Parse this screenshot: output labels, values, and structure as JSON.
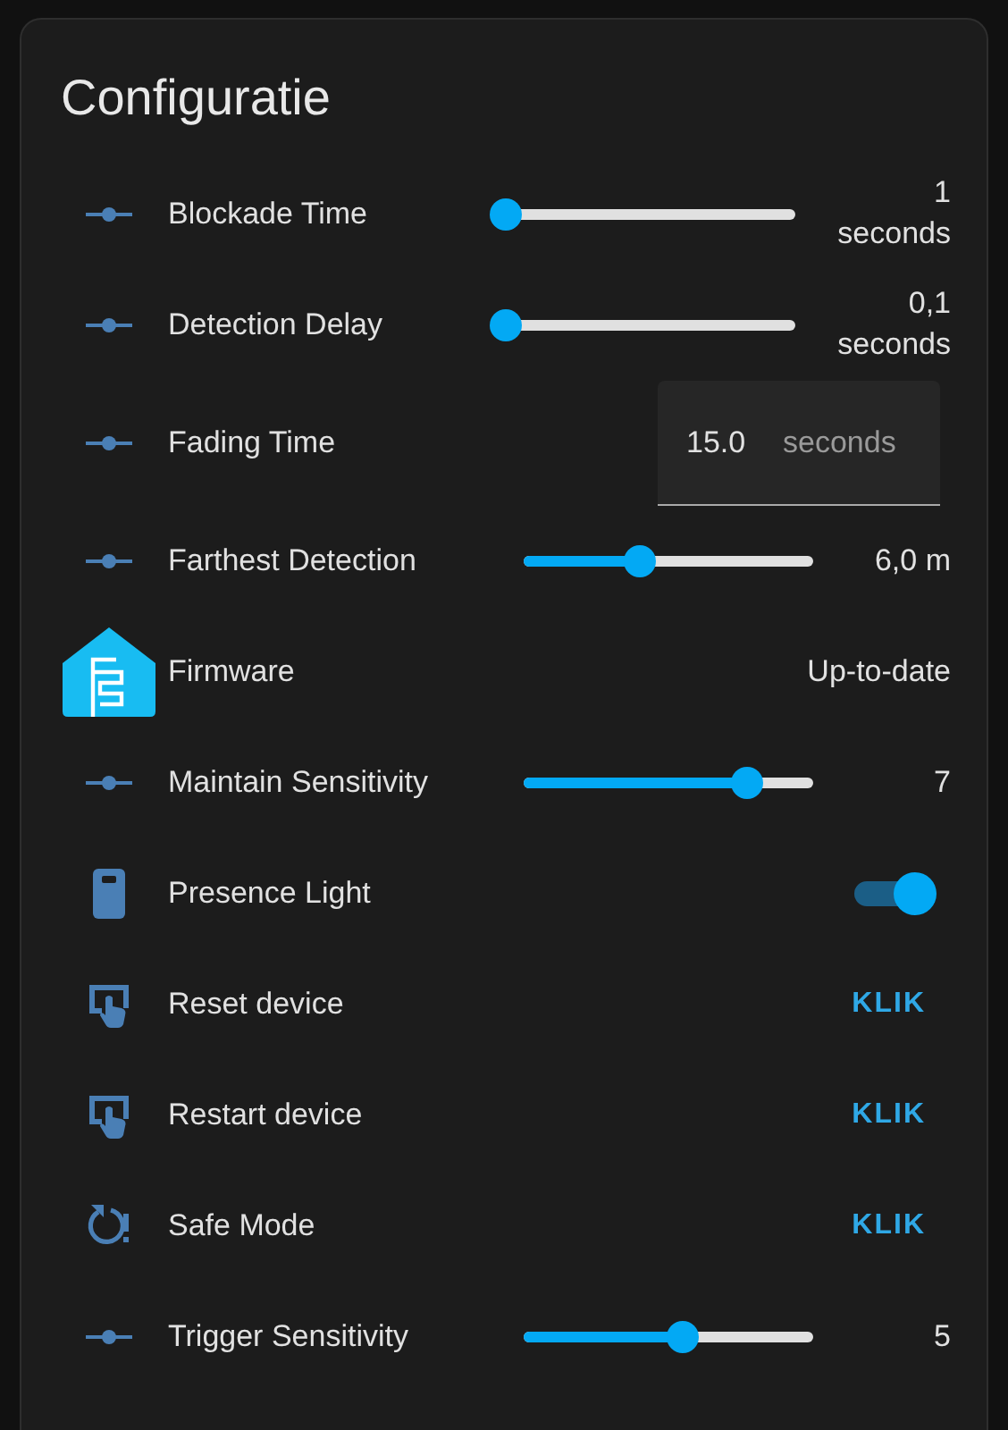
{
  "card": {
    "title": "Configuratie",
    "rows": [
      {
        "kind": "slider",
        "label": "Blockade Time",
        "level": 0,
        "value": "1 seconds"
      },
      {
        "kind": "slider",
        "label": "Detection Delay",
        "level": 0,
        "value": "0,1 seconds"
      },
      {
        "kind": "number",
        "label": "Fading Time",
        "value": "15.0",
        "unit": "seconds"
      },
      {
        "kind": "slider",
        "label": "Farthest Detection",
        "level": 0.4,
        "value": "6,0 m"
      },
      {
        "kind": "text",
        "label": "Firmware",
        "value": "Up-to-date"
      },
      {
        "kind": "slider",
        "label": "Maintain Sensitivity",
        "level": 0.77,
        "value": "7"
      },
      {
        "kind": "toggle",
        "label": "Presence Light",
        "on": true
      },
      {
        "kind": "button",
        "label": "Reset device",
        "action": "KLIK"
      },
      {
        "kind": "button",
        "label": "Restart device",
        "action": "KLIK"
      },
      {
        "kind": "button",
        "label": "Safe Mode",
        "action": "KLIK"
      },
      {
        "kind": "slider",
        "label": "Trigger Sensitivity",
        "level": 0.55,
        "value": "5"
      }
    ]
  }
}
